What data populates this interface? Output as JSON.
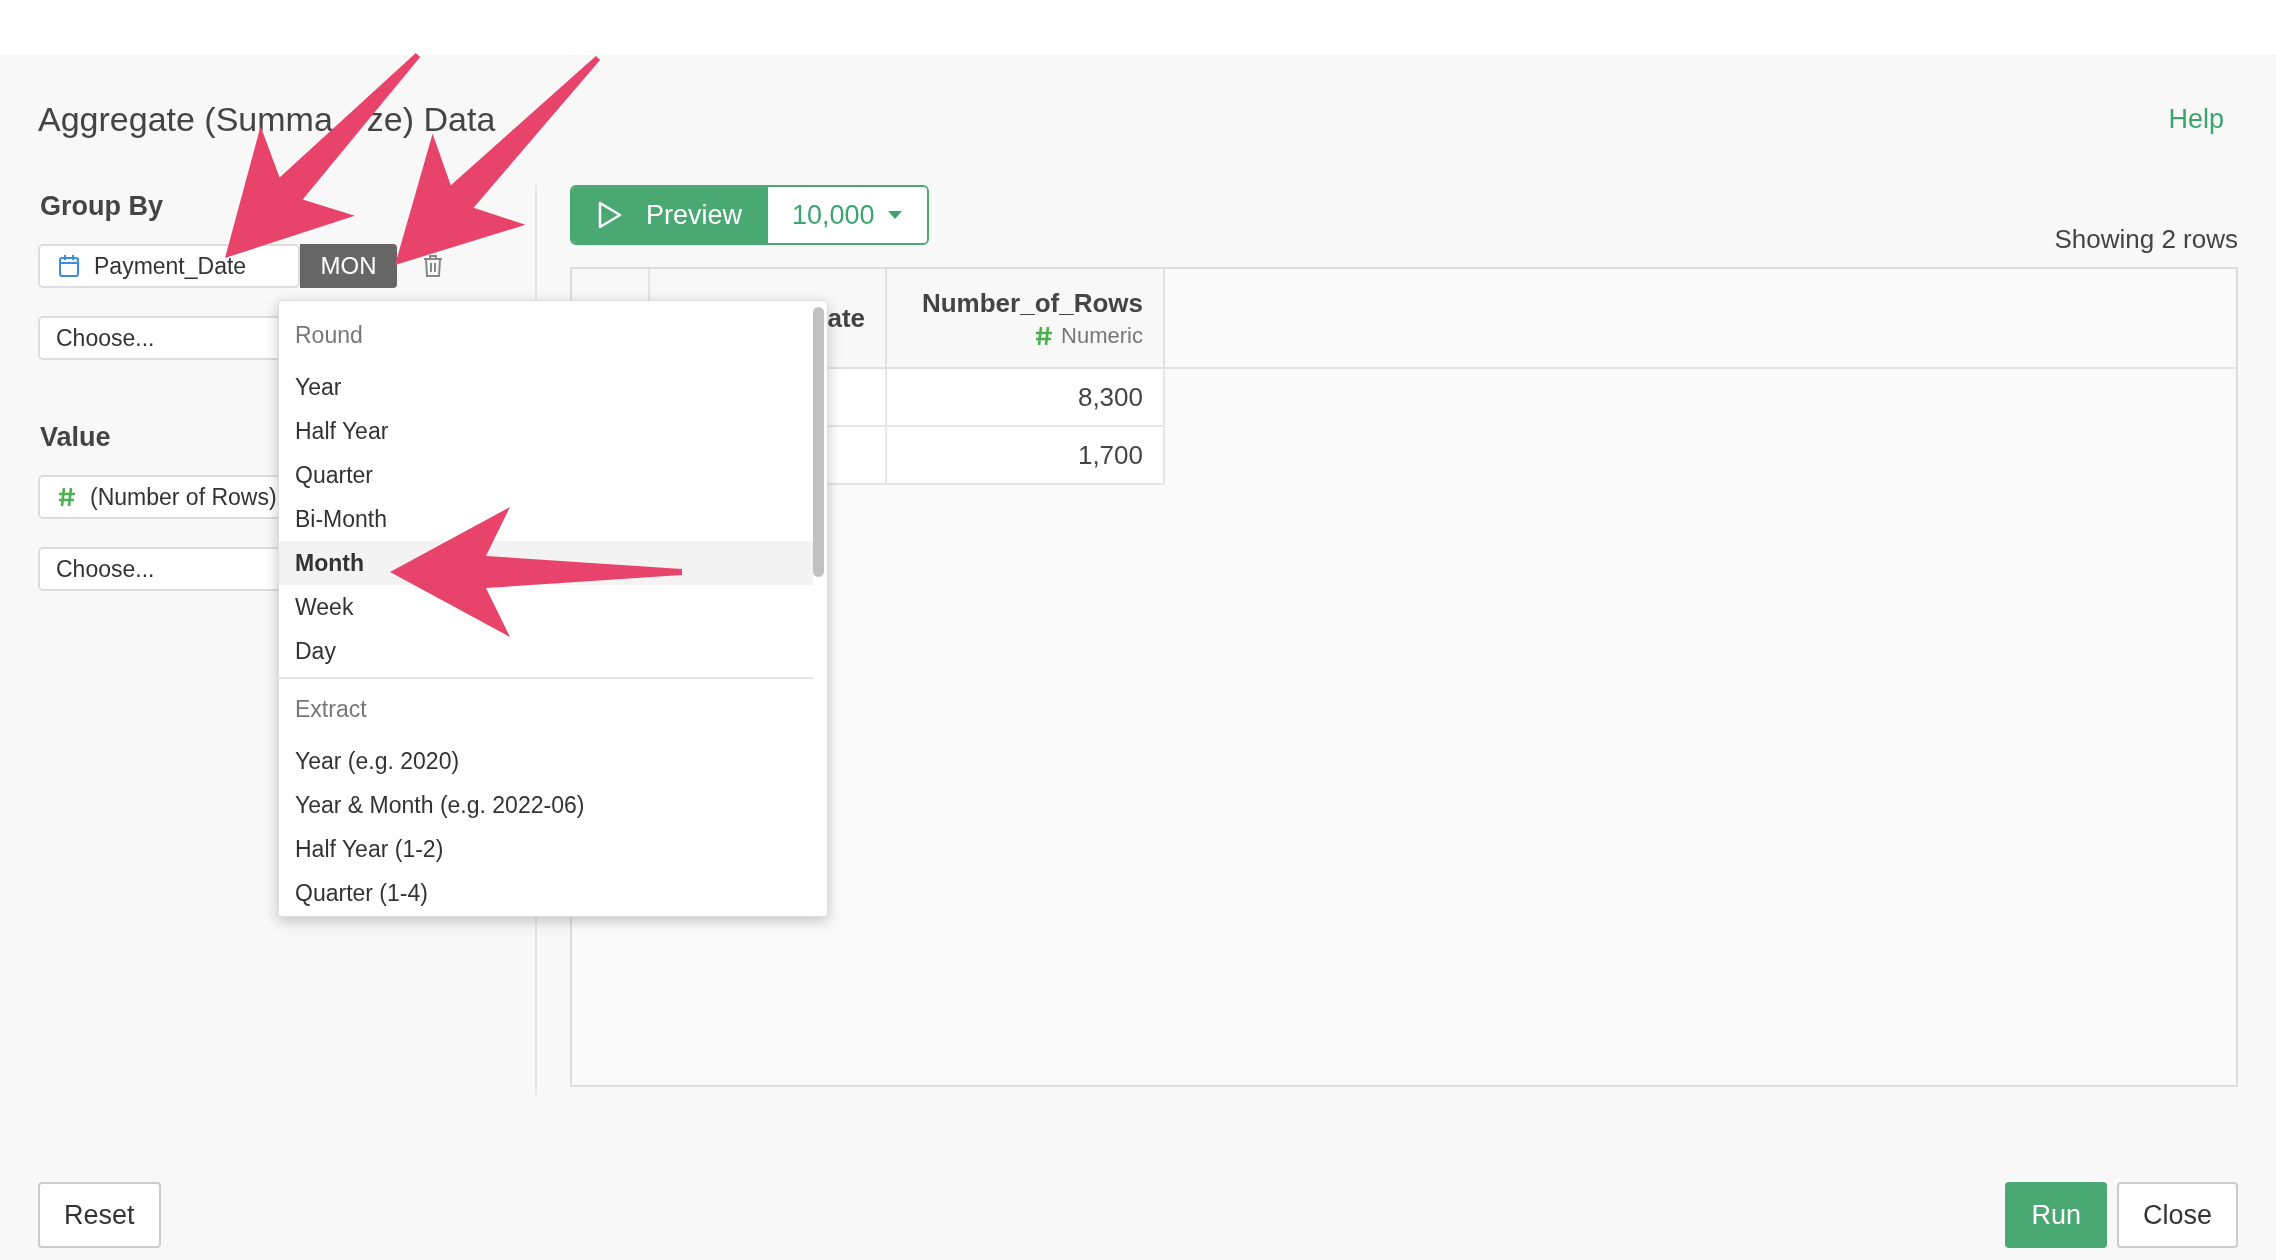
{
  "dialog": {
    "title_parts": [
      "Aggregate (Summa",
      "ze) Data"
    ],
    "help": "Help"
  },
  "group_by": {
    "label": "Group By",
    "column": {
      "name": "Payment_Date",
      "unit": "MON"
    },
    "placeholder": "Choose..."
  },
  "value": {
    "label": "Value",
    "column": {
      "name": "(Number of Rows)"
    },
    "placeholder": "Choose..."
  },
  "preview": {
    "label": "Preview",
    "row_limit": "10,000"
  },
  "status": "Showing 2 rows",
  "table": {
    "columns": [
      {
        "name": "ate"
      },
      {
        "name": "Number_of_Rows",
        "type": "Numeric"
      }
    ],
    "rows": [
      {
        "number_of_rows": "8,300"
      },
      {
        "number_of_rows": "1,700"
      }
    ]
  },
  "menu": {
    "sections": [
      {
        "heading": "Round",
        "items": [
          {
            "label": "Year",
            "selected": false
          },
          {
            "label": "Half Year",
            "selected": false
          },
          {
            "label": "Quarter",
            "selected": false
          },
          {
            "label": "Bi-Month",
            "selected": false
          },
          {
            "label": "Month",
            "selected": true
          },
          {
            "label": "Week",
            "selected": false
          },
          {
            "label": "Day",
            "selected": false
          }
        ]
      },
      {
        "heading": "Extract",
        "items": [
          {
            "label": "Year (e.g. 2020)",
            "selected": false
          },
          {
            "label": "Year & Month (e.g. 2022-06)",
            "selected": false
          },
          {
            "label": "Half Year (1-2)",
            "selected": false
          },
          {
            "label": "Quarter (1-4)",
            "selected": false
          }
        ]
      }
    ]
  },
  "footer": {
    "buttons": [
      {
        "label": "Reset",
        "kind": "default"
      },
      {
        "label": "Run",
        "kind": "primary"
      },
      {
        "label": "Close",
        "kind": "default"
      }
    ]
  }
}
